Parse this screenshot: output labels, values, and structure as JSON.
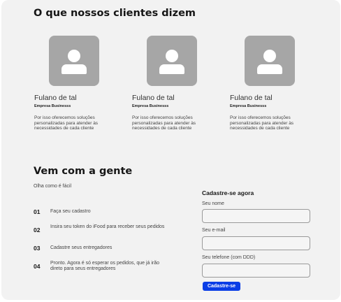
{
  "testimonials_section": {
    "title": "O que nossos clientes dizem",
    "items": [
      {
        "avatar_icon": "user-avatar-icon",
        "name": "Fulano de tal",
        "company": "Empresa Businesss",
        "text": "Por isso oferecemos soluções personalizadas para atender às necessidades de cada cliente"
      },
      {
        "avatar_icon": "user-avatar-icon",
        "name": "Fulano de tal",
        "company": "Empresa Businesss",
        "text": "Por isso oferecemos soluções personalizadas para atender às necessidades de cada cliente"
      },
      {
        "avatar_icon": "user-avatar-icon",
        "name": "Fulano de tal",
        "company": "Empresa Businesss",
        "text": "Por isso oferecemos soluções personalizadas para atender às necessidades de cada cliente"
      }
    ]
  },
  "join_section": {
    "title": "Vem com a gente",
    "subtitle": "Olha como é fácil",
    "steps": [
      {
        "number": "01",
        "text": "Faça seu cadastro"
      },
      {
        "number": "02",
        "text": "Insira seu token do iFood para receber seus pedidos"
      },
      {
        "number": "03",
        "text": "Cadastre seus entregadores"
      },
      {
        "number": "04",
        "text": "Pronto. Agora é só esperar os pedidos, que já irão direto para seus entregadores"
      }
    ]
  },
  "signup_form": {
    "title": "Cadastre-se agora",
    "name_label": "Seu nome",
    "name_value": "",
    "email_label": "Seu e-mail",
    "email_value": "",
    "phone_label": "Seu telefone (com DDD)",
    "phone_value": "",
    "submit_label": "Cadastre-se"
  },
  "colors": {
    "background": "#f2f2f2",
    "avatar": "#a6a6a6",
    "button": "#0b3ee6"
  }
}
